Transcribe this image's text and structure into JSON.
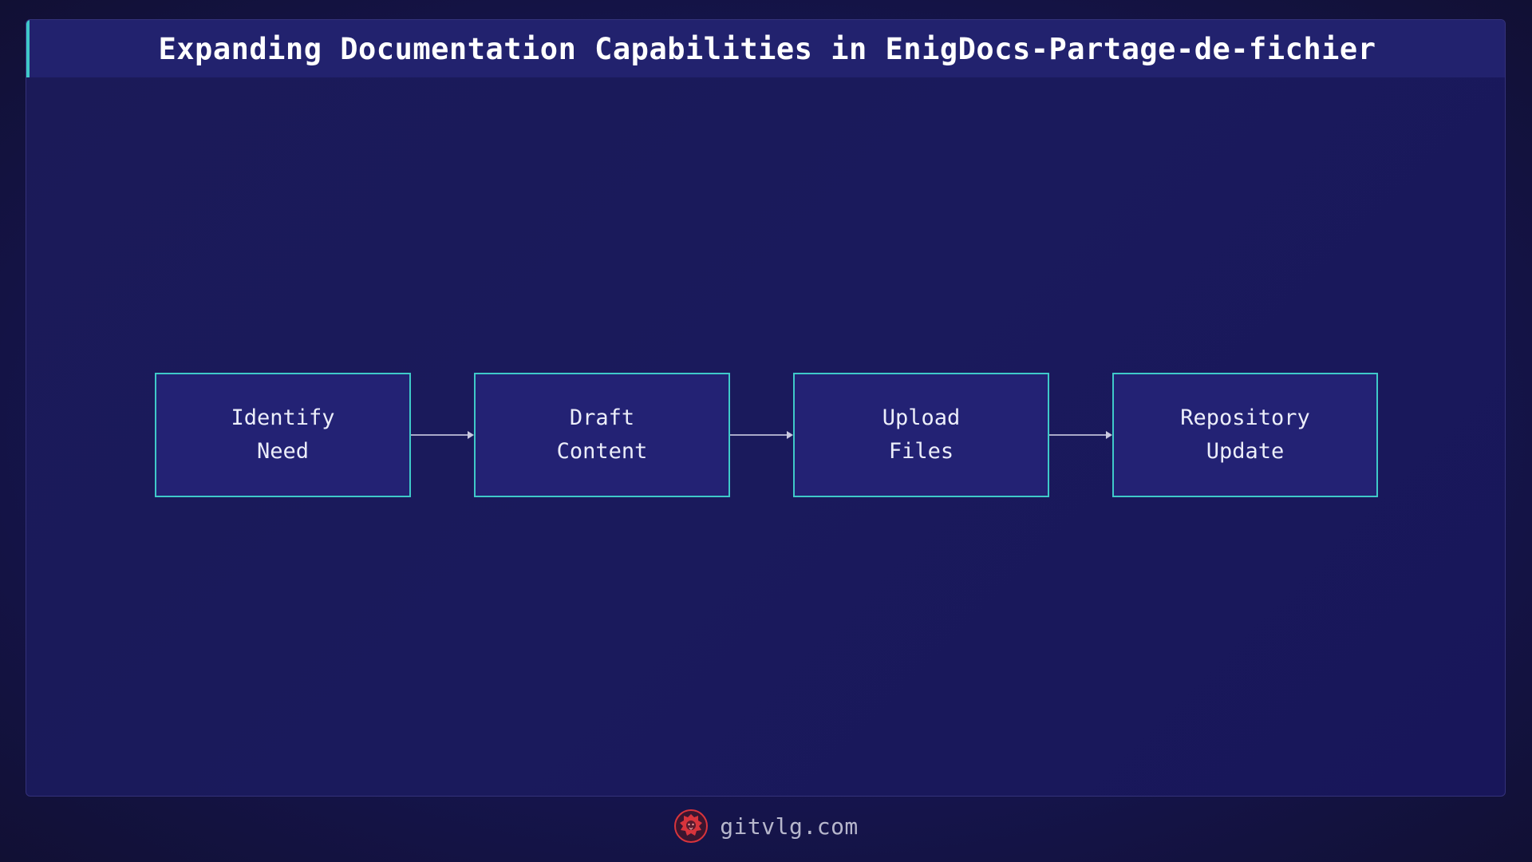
{
  "header": {
    "title": "Expanding Documentation Capabilities in EnigDocs-Partage-de-fichier"
  },
  "diagram": {
    "nodes": [
      {
        "line1": "Identify",
        "line2": "Need"
      },
      {
        "line1": "Draft",
        "line2": "Content"
      },
      {
        "line1": "Upload",
        "line2": "Files"
      },
      {
        "line1": "Repository",
        "line2": "Update"
      }
    ],
    "edges": [
      {
        "from": "Identify Need",
        "to": "Draft Content"
      },
      {
        "from": "Draft Content",
        "to": "Upload Files"
      },
      {
        "from": "Upload Files",
        "to": "Repository Update"
      }
    ]
  },
  "footer": {
    "site": "gitvlg.com",
    "logo_icon": "lion-logo-icon"
  },
  "colors": {
    "background": "#131238",
    "title_bar": "#22226e",
    "accent": "#3fc9c9",
    "node_fill": "#232274",
    "arrow": "#a9a9c8",
    "logo": "#d8343c"
  }
}
